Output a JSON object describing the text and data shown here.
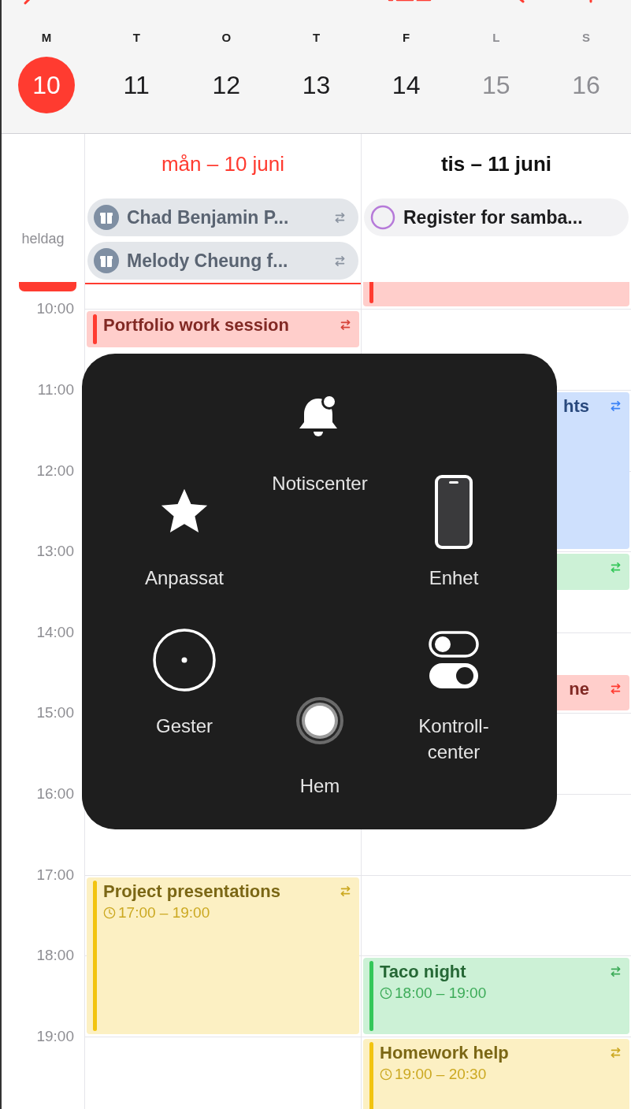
{
  "week": [
    {
      "letter": "M",
      "day": "10",
      "selected": true,
      "weekend": false
    },
    {
      "letter": "T",
      "day": "11",
      "selected": false,
      "weekend": false
    },
    {
      "letter": "O",
      "day": "12",
      "selected": false,
      "weekend": false
    },
    {
      "letter": "T",
      "day": "13",
      "selected": false,
      "weekend": false
    },
    {
      "letter": "F",
      "day": "14",
      "selected": false,
      "weekend": false
    },
    {
      "letter": "L",
      "day": "15",
      "selected": false,
      "weekend": true
    },
    {
      "letter": "S",
      "day": "16",
      "selected": false,
      "weekend": true
    }
  ],
  "all_day_label": "heldag",
  "days": [
    {
      "heading": "mån – 10 juni",
      "today": true,
      "all_day": [
        {
          "kind": "birthday",
          "title": "Chad Benjamin P...",
          "repeats": true
        },
        {
          "kind": "birthday",
          "title": "Melody Cheung f...",
          "repeats": true
        }
      ],
      "events": [
        {
          "title": "Portfolio work session",
          "color": "#ff3b30",
          "repeats": true,
          "covered": false
        },
        {
          "title": "Project presentations",
          "time": "17:00 – 19:00",
          "color": "#f2c40f",
          "repeats": true,
          "covered": false
        }
      ]
    },
    {
      "heading": "tis – 11 juni",
      "today": false,
      "all_day": [
        {
          "kind": "reminder",
          "title": "Register for samba...",
          "repeats": false
        }
      ],
      "events": [
        {
          "color": "#ff3b30",
          "repeats": false,
          "covered": false
        },
        {
          "title": "hts",
          "color": "#3b82f6",
          "repeats": true,
          "covered": true
        },
        {
          "color": "#34c759",
          "repeats": true,
          "covered": true
        },
        {
          "title": "ne",
          "color": "#ff3b30",
          "repeats": true,
          "covered": true
        },
        {
          "title": "Taco night",
          "time": "18:00 – 19:00",
          "color": "#34c759",
          "repeats": true,
          "covered": false
        },
        {
          "title": "Homework help",
          "time": "19:00 – 20:30",
          "color": "#f2c40f",
          "repeats": true,
          "covered": false
        }
      ]
    }
  ],
  "hours": [
    "10:00",
    "11:00",
    "12:00",
    "13:00",
    "14:00",
    "15:00",
    "16:00",
    "17:00",
    "18:00",
    "19:00"
  ],
  "menu": {
    "items": [
      {
        "kind": "bell",
        "label": "Notiscenter"
      },
      {
        "kind": "star",
        "label": "Anpassat"
      },
      {
        "kind": "phone",
        "label": "Enhet"
      },
      {
        "kind": "gesture",
        "label": "Gester"
      },
      {
        "kind": "home",
        "label": "Hem"
      },
      {
        "kind": "toggles",
        "label": "Kontroll-center"
      }
    ]
  }
}
